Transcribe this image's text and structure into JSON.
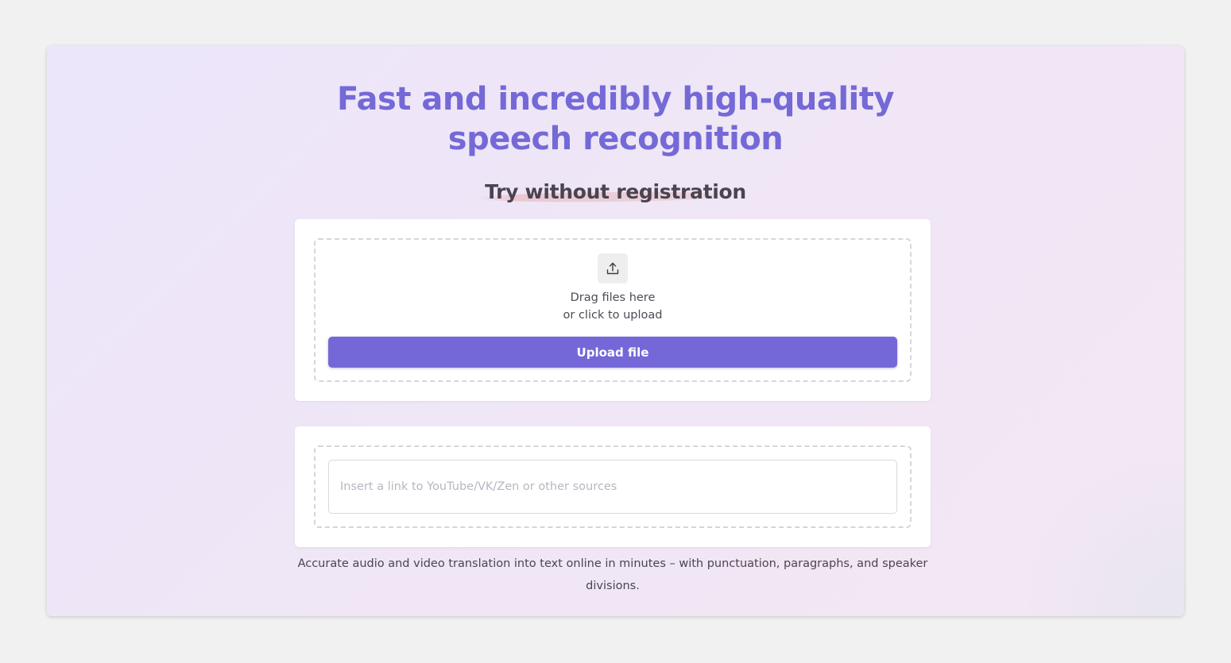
{
  "hero": {
    "title_line1": "Fast and incredibly high-quality",
    "title_line2": "speech recognition",
    "subtitle": "Try without registration"
  },
  "upload": {
    "icon": "upload-icon",
    "drag_text": "Drag files here",
    "click_text": "or click to upload",
    "button_label": "Upload file"
  },
  "link": {
    "placeholder": "Insert a link to YouTube/VK/Zen or other sources",
    "value": ""
  },
  "description": "Accurate audio and video translation into text online in minutes – with punctuation, paragraphs, and speaker divisions.",
  "colors": {
    "accent": "#7468d8",
    "title": "#7469d6",
    "page_background": "#f1f1f1"
  }
}
